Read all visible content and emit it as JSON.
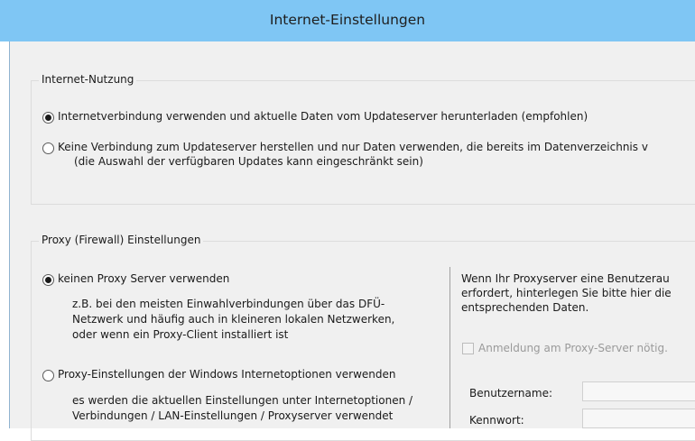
{
  "window": {
    "title": "Internet-Einstellungen"
  },
  "internet_usage": {
    "legend": "Internet-Nutzung",
    "option1": "Internetverbindung verwenden und aktuelle Daten vom Updateserver herunterladen (empfohlen)",
    "option2_line1": "Keine Verbindung zum Updateserver herstellen und nur Daten verwenden, die bereits im Datenverzeichnis v",
    "option2_line2": "(die Auswahl der verfügbaren Updates kann eingeschränkt sein)",
    "selected": "option1"
  },
  "proxy": {
    "legend": "Proxy (Firewall) Einstellungen",
    "no_proxy_label": "keinen Proxy Server verwenden",
    "no_proxy_desc": [
      "z.B. bei den meisten Einwahlverbindungen über das DFÜ-",
      "Netzwerk und häufig auch in kleineren lokalen Netzwerken,",
      "oder wenn ein Proxy-Client installiert ist"
    ],
    "windows_proxy_label": "Proxy-Einstellungen der Windows Internetoptionen verwenden",
    "windows_proxy_desc": [
      "es werden die aktuellen Einstellungen unter Internetoptionen /",
      "Verbindungen / LAN-Einstellungen / Proxyserver verwendet"
    ],
    "auth_info": [
      "Wenn Ihr Proxyserver eine Benutzerau",
      "erfordert, hinterlegen Sie bitte hier die",
      "entsprechenden Daten."
    ],
    "auth_checkbox_label": "Anmeldung am Proxy-Server nötig.",
    "username_label": "Benutzername:",
    "password_label": "Kennwort:",
    "username_value": "",
    "password_value": ""
  }
}
